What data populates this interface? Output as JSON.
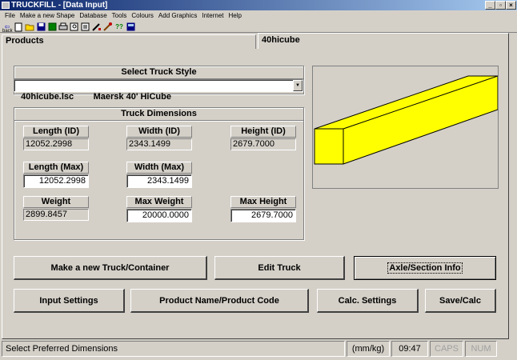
{
  "window": {
    "title": "TRUCKFILL - [Data Input]"
  },
  "menu": [
    "File",
    "Make a new Shape",
    "Database",
    "Tools",
    "Colours",
    "Add Graphics",
    "Internet",
    "Help"
  ],
  "toolbar": {
    "back_label": "back"
  },
  "tabs": {
    "left": "Products",
    "right": "40hicube"
  },
  "truck_style": {
    "title": "Select Truck Style",
    "selected": "40hicube.lsc        Maersk 40' HiCube"
  },
  "dimensions": {
    "title": "Truck Dimensions",
    "length_id_label": "Length (ID)",
    "length_id_value": "12052.2998",
    "width_id_label": "Width (ID)",
    "width_id_value": "2343.1499",
    "height_id_label": "Height (ID)",
    "height_id_value": "2679.7000",
    "length_max_label": "Length (Max)",
    "length_max_value": "12052.2998",
    "width_max_label": "Width (Max)",
    "width_max_value": "2343.1499",
    "weight_label": "Weight",
    "weight_value": "2899.8457",
    "max_weight_label": "Max Weight",
    "max_weight_value": "20000.0000",
    "max_height_label": "Max Height",
    "max_height_value": "2679.7000"
  },
  "buttons": {
    "make_new": "Make a new Truck/Container",
    "edit_truck": "Edit Truck",
    "axle_info": "Axle/Section Info",
    "input_settings": "Input Settings",
    "product_name": "Product Name/Product Code",
    "calc_settings": "Calc. Settings",
    "save_calc": "Save/Calc"
  },
  "status": {
    "message": "Select Preferred Dimensions",
    "units": "(mm/kg)",
    "time": "09:47",
    "caps": "CAPS",
    "num": "NUM"
  },
  "colors": {
    "truck_fill": "#ffff00",
    "titlebar": "#0a246a"
  }
}
